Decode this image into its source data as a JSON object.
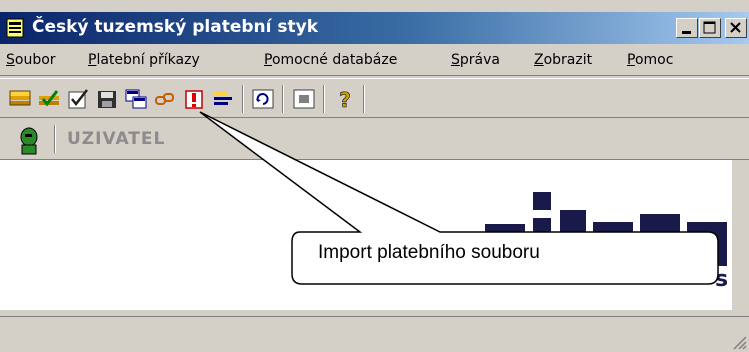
{
  "window": {
    "title": "Český tuzemský platební styk",
    "buttons": [
      "minimize",
      "maximize",
      "close"
    ]
  },
  "menu": {
    "items": [
      {
        "label": "Soubor"
      },
      {
        "label": "Platební příkazy"
      },
      {
        "label": "Pomocné databáze"
      },
      {
        "label": "Správa"
      },
      {
        "label": "Zobrazit"
      },
      {
        "label": "Pomoc"
      }
    ]
  },
  "toolbar": {
    "icons": [
      "new-payment-icon",
      "edit-payment-icon",
      "approve-icon",
      "save-icon",
      "import-icon",
      "link-icon",
      "delete-icon",
      "list-icon",
      "refresh-icon",
      "window-icon",
      "help-icon"
    ]
  },
  "user": {
    "name": "UZIVATEL"
  },
  "callout": {
    "text": "Import platebního souboru"
  },
  "colors": {
    "title_start": "#0a246a",
    "title_end": "#a6caf0",
    "face": "#d4d0c8",
    "user_text": "#8c8c8c"
  }
}
